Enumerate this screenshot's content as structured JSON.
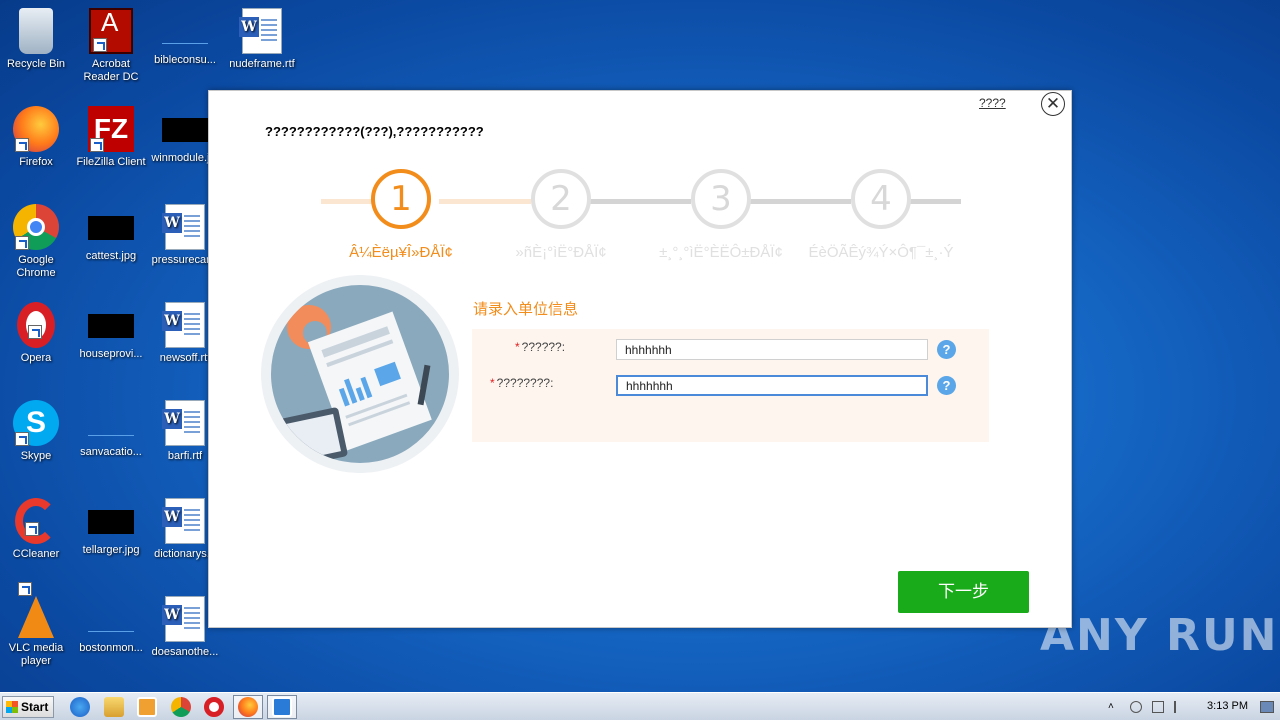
{
  "desktop": {
    "icons": [
      {
        "label": "Recycle Bin"
      },
      {
        "label": "Acrobat Reader DC"
      },
      {
        "label": "bibleconsu..."
      },
      {
        "label": "nudeframe.rtf"
      },
      {
        "label": "Firefox"
      },
      {
        "label": "FileZilla Client"
      },
      {
        "label": "winmodule.j..."
      },
      {
        "label": "Google Chrome"
      },
      {
        "label": "cattest.jpg"
      },
      {
        "label": "pressurecar..."
      },
      {
        "label": "Opera"
      },
      {
        "label": "houseprovi..."
      },
      {
        "label": "newsoff.rtf"
      },
      {
        "label": "Skype"
      },
      {
        "label": "sanvacatio..."
      },
      {
        "label": "barfi.rtf"
      },
      {
        "label": "CCleaner"
      },
      {
        "label": "tellarger.jpg"
      },
      {
        "label": "dictionarys..."
      },
      {
        "label": "VLC media player"
      },
      {
        "label": "bostonmon..."
      },
      {
        "label": "doesanothe..."
      }
    ]
  },
  "dialog": {
    "help_link": "????",
    "close_glyph": "✕",
    "title": "????????????(???),???????????",
    "steps": [
      {
        "number": "1",
        "label": "Â¼Èëµ¥Î»ÐÅÏ¢",
        "active": true
      },
      {
        "number": "2",
        "label": "»ñÈ¡°ìË°ÐÅÏ¢",
        "active": false
      },
      {
        "number": "3",
        "label": "±¸°¸°ìË°ÈËÔ±ÐÅÏ¢",
        "active": false
      },
      {
        "number": "4",
        "label": "ÉèÖÃÊý¾Ý×Ô¶¯±¸·Ý",
        "active": false
      }
    ],
    "form": {
      "section_title": "请录入单位信息",
      "required_mark": "*",
      "fields": [
        {
          "label": "??????:",
          "value": "hhhhhhh"
        },
        {
          "label": "????????:",
          "value": "hhhhhhh"
        }
      ],
      "help_glyph": "?"
    },
    "next_button": "下一步"
  },
  "watermark": "ANY RUN",
  "taskbar": {
    "start_label": "Start",
    "time": "3:13 PM"
  },
  "colors": {
    "accent": "#f28c1a",
    "button_green": "#1aab1a",
    "help_blue": "#5aa6e8",
    "required_red": "#e02020"
  }
}
